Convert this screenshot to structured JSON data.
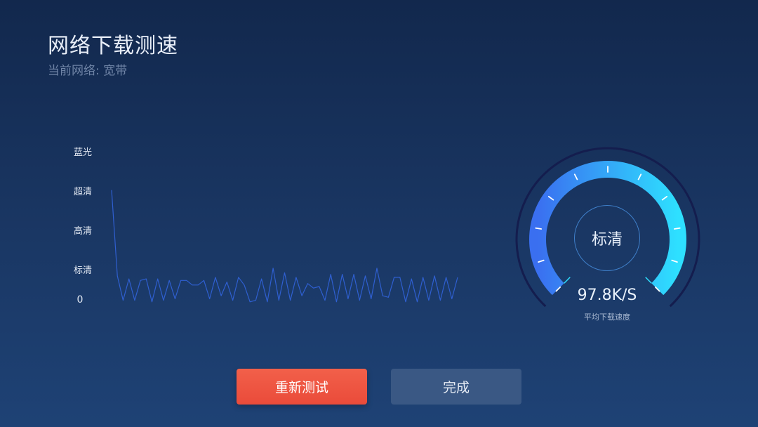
{
  "header": {
    "title": "网络下载测速",
    "subtitle": "当前网络: 宽带"
  },
  "chart_data": {
    "type": "line",
    "y_levels": [
      "蓝光",
      "超清",
      "高清",
      "标清",
      "0"
    ],
    "series_color": "#2f5fd0",
    "values": [
      0.74,
      0.18,
      0.02,
      0.16,
      0.02,
      0.15,
      0.16,
      0.01,
      0.16,
      0.02,
      0.15,
      0.03,
      0.15,
      0.15,
      0.12,
      0.12,
      0.15,
      0.03,
      0.17,
      0.05,
      0.14,
      0.02,
      0.17,
      0.12,
      0.01,
      0.02,
      0.16,
      0.01,
      0.23,
      0.02,
      0.2,
      0.02,
      0.17,
      0.05,
      0.13,
      0.1,
      0.11,
      0.02,
      0.19,
      0.01,
      0.19,
      0.03,
      0.19,
      0.02,
      0.18,
      0.03,
      0.23,
      0.05,
      0.04,
      0.17,
      0.17,
      0.01,
      0.16,
      0.01,
      0.17,
      0.02,
      0.18,
      0.02,
      0.17,
      0.03,
      0.17
    ]
  },
  "gauge": {
    "quality": "标清",
    "speed": "97.8K/S",
    "caption": "平均下载速度",
    "colors": {
      "arc_start": "#3a6ff0",
      "arc_end": "#2ee0ff",
      "outer_ring": "#141d4e",
      "tick": "#ffffff"
    }
  },
  "buttons": {
    "retest": "重新测试",
    "done": "完成"
  }
}
